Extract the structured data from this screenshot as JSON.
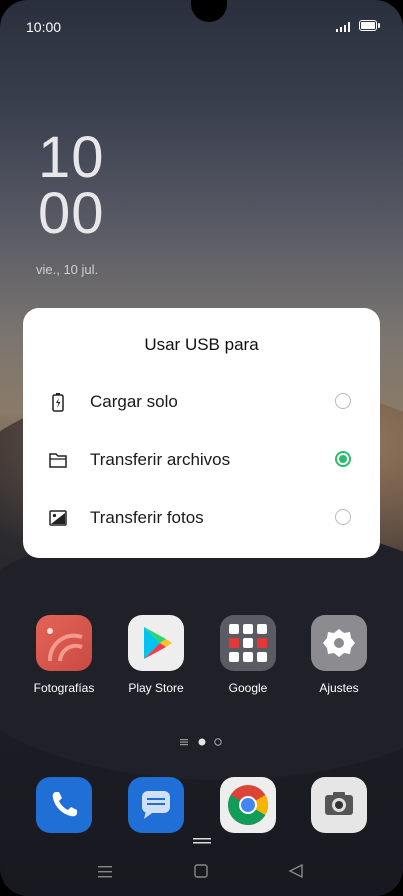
{
  "status_bar": {
    "time": "10:00"
  },
  "lock_clock": {
    "hours": "10",
    "minutes": "00",
    "date": "vie., 10 jul."
  },
  "dialog": {
    "title": "Usar USB para",
    "options": [
      {
        "label": "Cargar solo",
        "icon": "battery-charging-icon",
        "selected": false
      },
      {
        "label": "Transferir archivos",
        "icon": "folder-icon",
        "selected": true
      },
      {
        "label": "Transferir fotos",
        "icon": "image-icon",
        "selected": false
      }
    ],
    "accent_color": "#2bbd6a"
  },
  "home_apps": [
    {
      "label": "Fotografías",
      "icon": "photos-icon"
    },
    {
      "label": "Play Store",
      "icon": "play-store-icon"
    },
    {
      "label": "Google",
      "icon": "google-folder-icon"
    },
    {
      "label": "Ajustes",
      "icon": "settings-icon"
    }
  ],
  "dock": [
    {
      "icon": "phone-icon"
    },
    {
      "icon": "messages-icon"
    },
    {
      "icon": "chrome-icon"
    },
    {
      "icon": "camera-icon"
    }
  ],
  "page_indicator": {
    "pages": 2,
    "current": 1
  }
}
